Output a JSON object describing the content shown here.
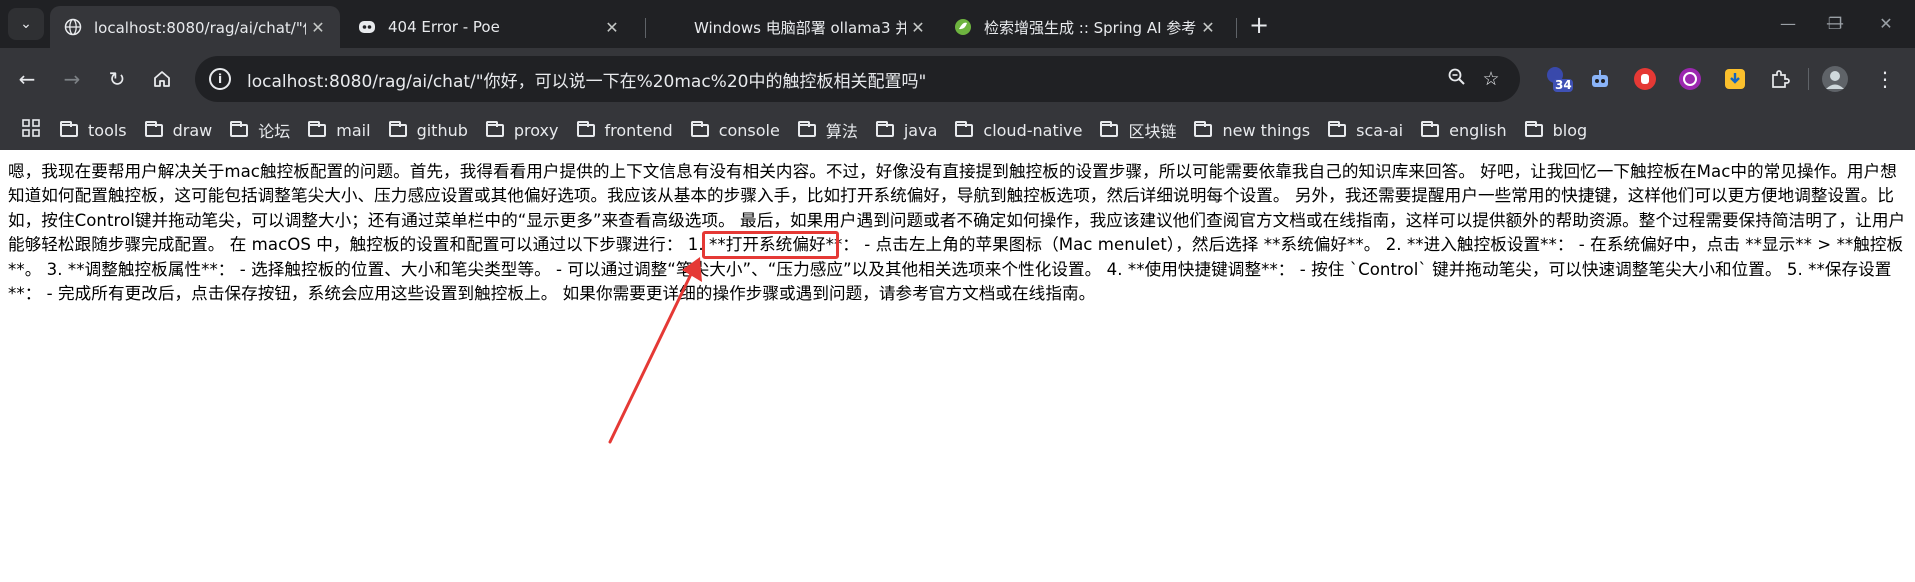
{
  "tabs": [
    {
      "title": "localhost:8080/rag/ai/chat/\"你",
      "favicon": "globe-icon",
      "active": true
    },
    {
      "title": "404 Error - Poe",
      "favicon": "poe-icon",
      "active": false
    },
    {
      "title": "Windows 电脑部署 ollama3 并",
      "favicon": "none",
      "active": false
    },
    {
      "title": "检索增强生成 :: Spring AI 参考",
      "favicon": "spring-icon",
      "active": false
    }
  ],
  "address": {
    "url": "localhost:8080/rag/ai/chat/\"你好，可以说一下在%20mac%20中的触控板相关配置吗\""
  },
  "extensions": {
    "badge_count": "34"
  },
  "bookmarks": [
    "tools",
    "draw",
    "论坛",
    "mail",
    "github",
    "proxy",
    "frontend",
    "console",
    "算法",
    "java",
    "cloud-native",
    "区块链",
    "new things",
    "sca-ai",
    "english",
    "blog"
  ],
  "content": {
    "text_before": "嗯，我现在要帮用户解决关于mac触控板配置的问题。首先，我得看看用户提供的上下文信息有没有相关内容。不过，好像没有直接提到触控板的设置步骤，所以可能需要依靠我自己的知识库来回答。 好吧，让我回忆一下触控板在Mac中的常见操作。用户想知道如何配置触控板，这可能包括调整笔尖大小、压力感应设置或其他偏好选项。我应该从基本的步骤入手，比如打开系统偏好，导航到触控板选项，然后详细说明每个设置。 另外，我还需要提醒用户一些常用的快捷键，这样他们可以更方便地调整设置。比如，按住Control键并拖动笔尖，可以调整大小；还有通过菜单栏中的“显示更多”来查看高级选项。 最后，如果用户遇到问题或者不确定如何操作，我应该建议他们查阅官方文档或在线指南，这样可以提供额外的帮助资源。整个过程需要保持简洁明了，让用户能够轻松跟随步骤完成配置。 ",
    "highlight": "在 macOS 中，",
    "text_after": "触控板的设置和配置可以通过以下步骤进行： 1. **打开系统偏好**： - 点击左上角的苹果图标（Mac menulet），然后选择 **系统偏好**。 2. **进入触控板设置**： - 在系统偏好中，点击 **显示** > **触控板**。 3. **调整触控板属性**： - 选择触控板的位置、大小和笔尖类型等。 - 可以通过调整“笔尖大小”、“压力感应”以及其他相关选项来个性化设置。 4. **使用快捷键调整**： - 按住 `Control` 键并拖动笔尖，可以快速调整笔尖大小和位置。 5. **保存设置**： - 完成所有更改后，点击保存按钮，系统会应用这些设置到触控板上。 如果你需要更详细的操作步骤或遇到问题，请参考官方文档或在线指南。"
  },
  "colors": {
    "tabstrip_bg": "#202124",
    "toolbar_bg": "#35363a",
    "annotation": "#e53935"
  }
}
